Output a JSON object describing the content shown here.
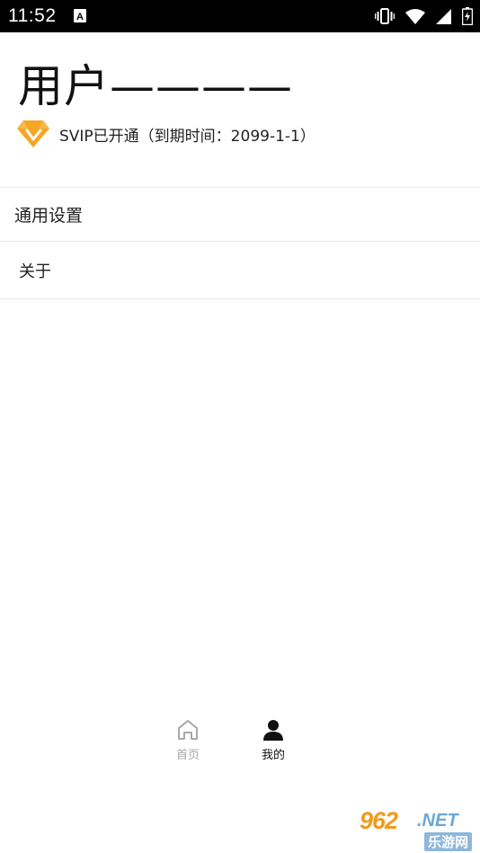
{
  "status_bar": {
    "time": "11:52",
    "icons": [
      "a-notification-icon",
      "vibrate-icon",
      "wifi-icon",
      "battery-icon"
    ]
  },
  "profile": {
    "username": "用户————",
    "vip_text": "SVIP已开通（到期时间：2099-1-1）",
    "vip_icon": "diamond-icon",
    "vip_color": "#f5a623"
  },
  "menu": {
    "items": [
      {
        "label": "通用设置"
      },
      {
        "label": "关于"
      }
    ]
  },
  "tabbar": {
    "tabs": [
      {
        "label": "首页",
        "icon": "home-icon",
        "active": false
      },
      {
        "label": "我的",
        "icon": "person-icon",
        "active": true
      }
    ]
  },
  "watermark": {
    "number": "962",
    "suffix": ".NET",
    "subtitle": "乐游网"
  }
}
